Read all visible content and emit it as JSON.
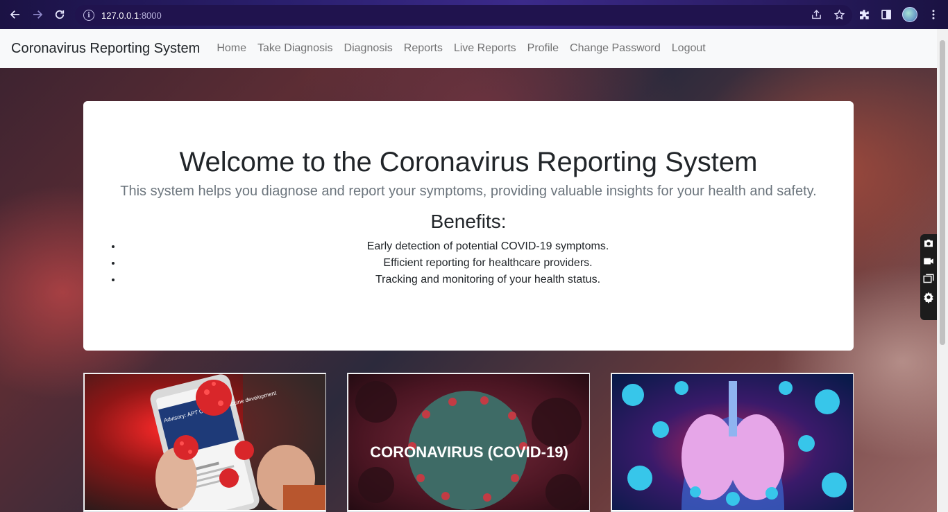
{
  "browser": {
    "url_host": "127.0.0.1",
    "url_port": ":8000"
  },
  "navbar": {
    "brand": "Coronavirus Reporting System",
    "links": [
      "Home",
      "Take Diagnosis",
      "Diagnosis",
      "Reports",
      "Live Reports",
      "Profile",
      "Change Password",
      "Logout"
    ]
  },
  "welcome": {
    "title": "Welcome to the Coronavirus Reporting System",
    "lead": "This system helps you diagnose and report your symptoms, providing valuable insights for your health and safety.",
    "benefits_heading": "Benefits:",
    "benefits": [
      "Early detection of potential COVID-19 symptoms.",
      "Efficient reporting for healthcare providers.",
      "Tracking and monitoring of your health status."
    ]
  },
  "cards": [
    {
      "image": "phone-with-virus",
      "phone_text": "Advisory: APT COVID-19 vaccine development"
    },
    {
      "image": "coronavirus-covid19",
      "caption": "CORONAVIRUS (COVID-19)"
    },
    {
      "image": "lungs-with-virus"
    }
  ],
  "icons": [
    "back-icon",
    "forward-icon",
    "reload-icon",
    "info-icon",
    "share-icon",
    "star-icon",
    "extensions-icon",
    "sidepanel-icon",
    "profile-avatar",
    "menu-icon",
    "camera-icon",
    "video-icon",
    "window-icon",
    "gear-icon"
  ]
}
